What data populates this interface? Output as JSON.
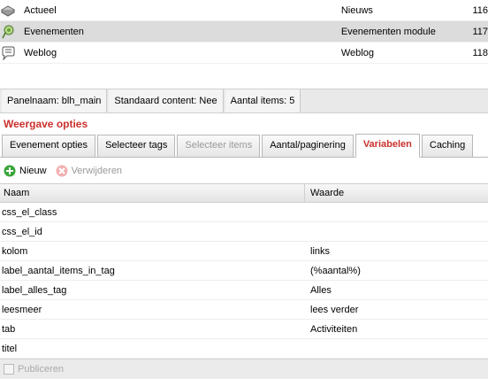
{
  "top_list": [
    {
      "name": "Actueel",
      "type": "Nieuws",
      "count": "116",
      "icon": "news-icon",
      "selected": false
    },
    {
      "name": "Evenementen",
      "type": "Evenementen module",
      "count": "117",
      "icon": "events-icon",
      "selected": true
    },
    {
      "name": "Weblog",
      "type": "Weblog",
      "count": "118",
      "icon": "weblog-icon",
      "selected": false
    }
  ],
  "panel": {
    "name": "Panelnaam: blh_main",
    "default_content": "Standaard content: Nee",
    "items": "Aantal items: 5"
  },
  "section_title": "Weergave opties",
  "tabs": [
    {
      "label": "Evenement opties",
      "state": "normal"
    },
    {
      "label": "Selecteer tags",
      "state": "normal"
    },
    {
      "label": "Selecteer items",
      "state": "disabled"
    },
    {
      "label": "Aantal/paginering",
      "state": "normal"
    },
    {
      "label": "Variabelen",
      "state": "active"
    },
    {
      "label": "Caching",
      "state": "normal"
    }
  ],
  "toolbar": {
    "new_label": "Nieuw",
    "delete_label": "Verwijderen"
  },
  "grid": {
    "headers": {
      "name": "Naam",
      "value": "Waarde"
    },
    "rows": [
      {
        "name": "css_el_class",
        "value": ""
      },
      {
        "name": "css_el_id",
        "value": ""
      },
      {
        "name": "kolom",
        "value": "links"
      },
      {
        "name": "label_aantal_items_in_tag",
        "value": "(%aantal%)"
      },
      {
        "name": "label_alles_tag",
        "value": "Alles"
      },
      {
        "name": "leesmeer",
        "value": "lees verder"
      },
      {
        "name": "tab",
        "value": "Activiteiten"
      },
      {
        "name": "titel",
        "value": ""
      }
    ]
  },
  "footer": {
    "publish_label": "Publiceren"
  },
  "colors": {
    "accent": "#c9302c",
    "selected_row": "#dcdcdc",
    "add_green": "#3aa53a",
    "delete_red": "#e06060"
  }
}
